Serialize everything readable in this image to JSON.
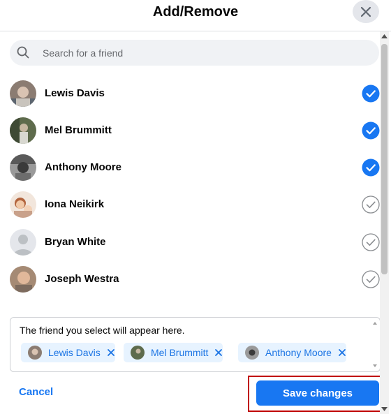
{
  "dialog": {
    "title": "Add/Remove"
  },
  "search": {
    "placeholder": "Search for a friend",
    "value": ""
  },
  "friends": [
    {
      "name": "Lewis Davis",
      "selected": true
    },
    {
      "name": "Mel Brummitt",
      "selected": true
    },
    {
      "name": "Anthony Moore",
      "selected": true
    },
    {
      "name": "Iona Neikirk",
      "selected": false
    },
    {
      "name": "Bryan White",
      "selected": false
    },
    {
      "name": "Joseph Westra",
      "selected": false
    }
  ],
  "selection": {
    "hint": "The friend you select will appear here.",
    "chips": [
      {
        "name": "Lewis Davis"
      },
      {
        "name": "Mel Brummitt"
      },
      {
        "name": "Anthony Moore"
      }
    ]
  },
  "footer": {
    "cancel_label": "Cancel",
    "save_label": "Save changes"
  },
  "colors": {
    "accent": "#1877f2",
    "chip_bg": "#e7f3ff",
    "highlight": "#c00000"
  }
}
